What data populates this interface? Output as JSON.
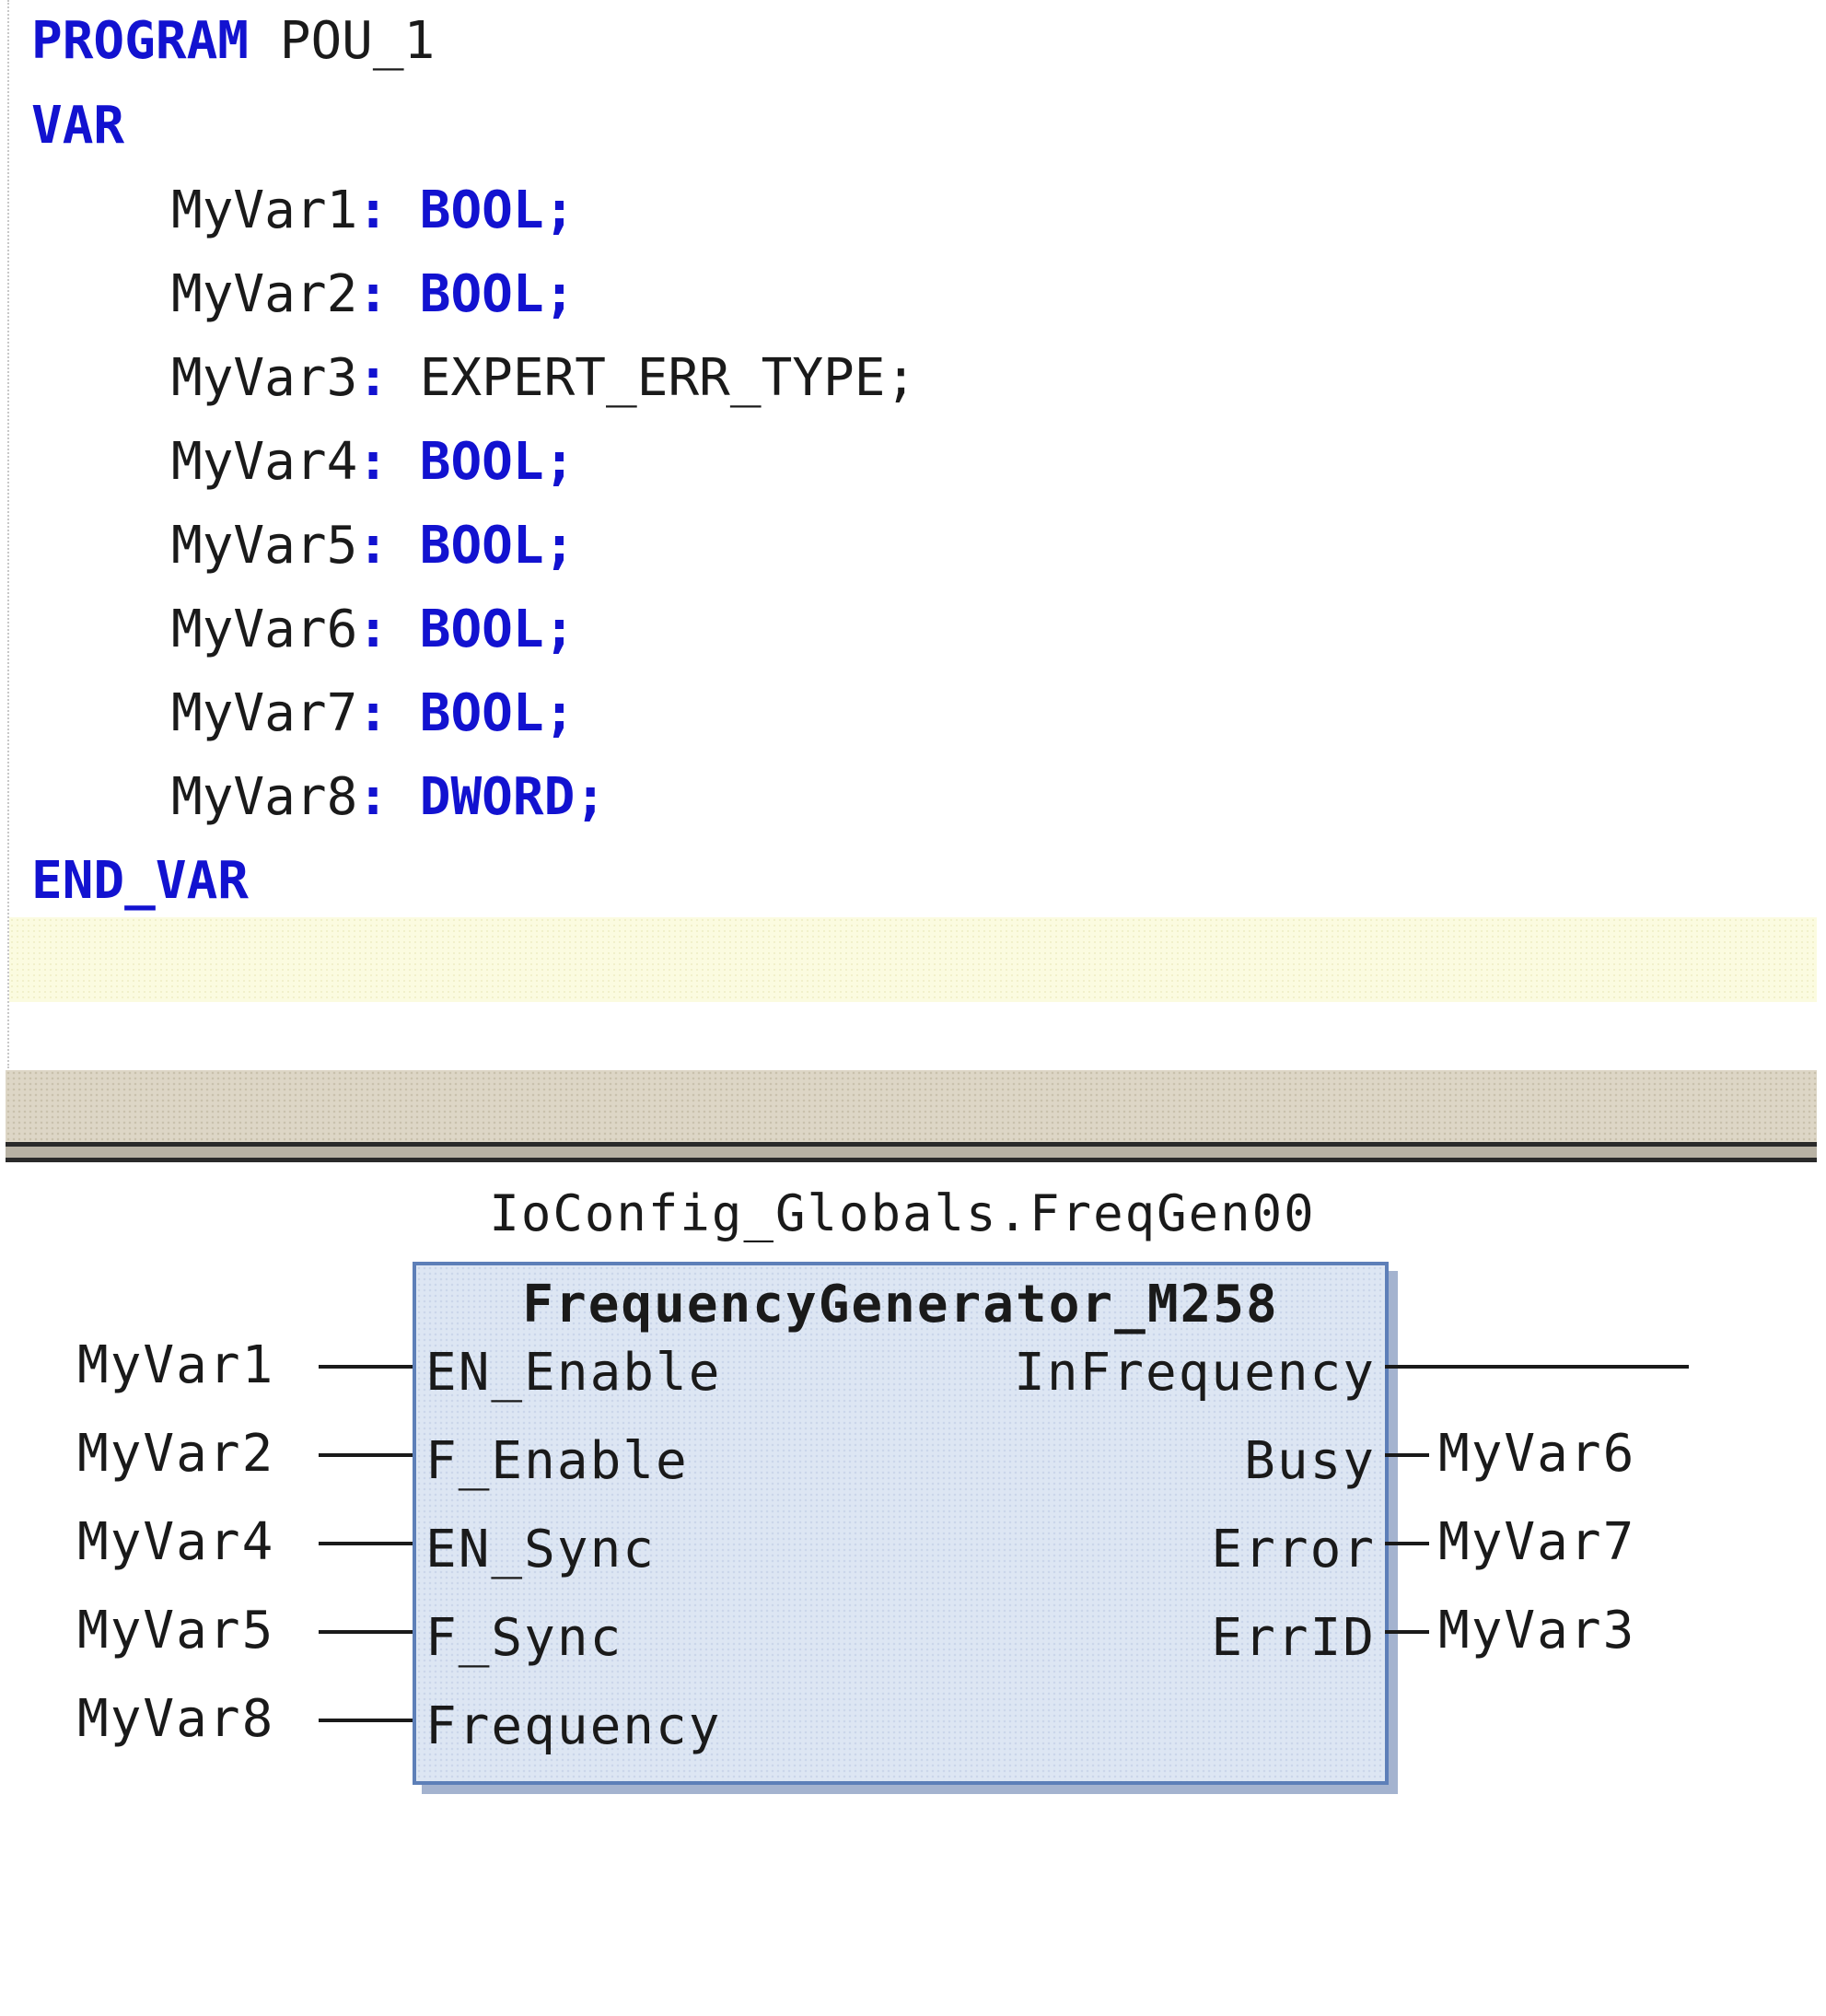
{
  "declaration": {
    "program_keyword": "PROGRAM",
    "program_name": "POU_1",
    "var_keyword": "VAR",
    "end_var_keyword": "END_VAR",
    "variables": [
      {
        "name": "MyVar1",
        "type": "BOOL",
        "type_is_keyword": true
      },
      {
        "name": "MyVar2",
        "type": "BOOL",
        "type_is_keyword": true
      },
      {
        "name": "MyVar3",
        "type": "EXPERT_ERR_TYPE",
        "type_is_keyword": false
      },
      {
        "name": "MyVar4",
        "type": "BOOL",
        "type_is_keyword": true
      },
      {
        "name": "MyVar5",
        "type": "BOOL",
        "type_is_keyword": true
      },
      {
        "name": "MyVar6",
        "type": "BOOL",
        "type_is_keyword": true
      },
      {
        "name": "MyVar7",
        "type": "BOOL",
        "type_is_keyword": true
      },
      {
        "name": "MyVar8",
        "type": "DWORD",
        "type_is_keyword": true
      }
    ]
  },
  "network": {
    "instance_name": "IoConfig_Globals.FreqGen00",
    "block_type": "FrequencyGenerator_M258",
    "inputs": [
      {
        "pin": "EN_Enable",
        "variable": "MyVar1"
      },
      {
        "pin": "F_Enable",
        "variable": "MyVar2"
      },
      {
        "pin": "EN_Sync",
        "variable": "MyVar4"
      },
      {
        "pin": "F_Sync",
        "variable": "MyVar5"
      },
      {
        "pin": "Frequency",
        "variable": "MyVar8"
      }
    ],
    "outputs": [
      {
        "pin": "InFrequency",
        "variable": ""
      },
      {
        "pin": "Busy",
        "variable": "MyVar6"
      },
      {
        "pin": "Error",
        "variable": "MyVar7"
      },
      {
        "pin": "ErrID",
        "variable": "MyVar3"
      }
    ]
  },
  "colors": {
    "keyword": "#1212d0",
    "block_border": "#5d7fb8",
    "block_fill": "#dde6f3",
    "cursor_line": "#fbfbe0"
  }
}
